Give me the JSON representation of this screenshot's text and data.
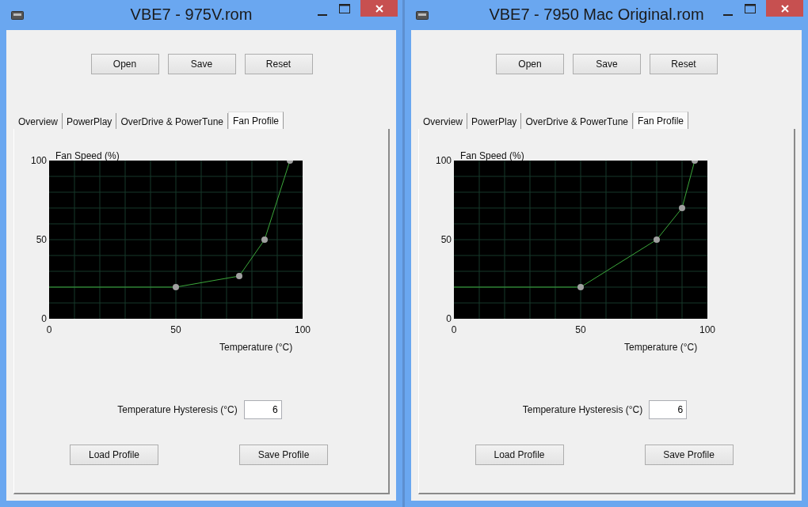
{
  "windows": [
    {
      "title": "VBE7 - 975V.rom",
      "toolbar_buttons": [
        "Open",
        "Save",
        "Reset"
      ],
      "tabs": [
        {
          "label": "Overview",
          "selected": false
        },
        {
          "label": "PowerPlay",
          "selected": false
        },
        {
          "label": "OverDrive & PowerTune",
          "selected": false
        },
        {
          "label": "Fan Profile",
          "selected": true
        }
      ],
      "fan_profile": {
        "chart_data": {
          "type": "line",
          "xlabel": "Temperature (°C)",
          "ylabel": "Fan Speed (%)",
          "x": [
            0,
            50,
            75,
            85,
            95
          ],
          "series": [
            {
              "color": "#3ca83c",
              "marker": "circle",
              "values": [
                20,
                20,
                27,
                50,
                100
              ]
            }
          ],
          "xlim": [
            0,
            100
          ],
          "ylim": [
            0,
            100
          ],
          "xticks": [
            0,
            50,
            100
          ],
          "yticks": [
            0,
            50,
            100
          ]
        },
        "hysteresis": {
          "label": "Temperature Hysteresis (°C)",
          "value": "6"
        },
        "buttons": [
          "Load Profile",
          "Save Profile"
        ]
      }
    },
    {
      "title": "VBE7 - 7950 Mac Original.rom",
      "toolbar_buttons": [
        "Open",
        "Save",
        "Reset"
      ],
      "tabs": [
        {
          "label": "Overview",
          "selected": false
        },
        {
          "label": "PowerPlay",
          "selected": false
        },
        {
          "label": "OverDrive & PowerTune",
          "selected": false
        },
        {
          "label": "Fan Profile",
          "selected": true
        }
      ],
      "fan_profile": {
        "chart_data": {
          "type": "line",
          "xlabel": "Temperature (°C)",
          "ylabel": "Fan Speed (%)",
          "x": [
            0,
            50,
            80,
            90,
            95
          ],
          "series": [
            {
              "color": "#3ca83c",
              "marker": "circle",
              "values": [
                20,
                20,
                50,
                70,
                100
              ]
            }
          ],
          "xlim": [
            0,
            100
          ],
          "ylim": [
            0,
            100
          ],
          "xticks": [
            0,
            50,
            100
          ],
          "yticks": [
            0,
            50,
            100
          ]
        },
        "hysteresis": {
          "label": "Temperature Hysteresis (°C)",
          "value": "6"
        },
        "buttons": [
          "Load Profile",
          "Save Profile"
        ]
      }
    }
  ]
}
